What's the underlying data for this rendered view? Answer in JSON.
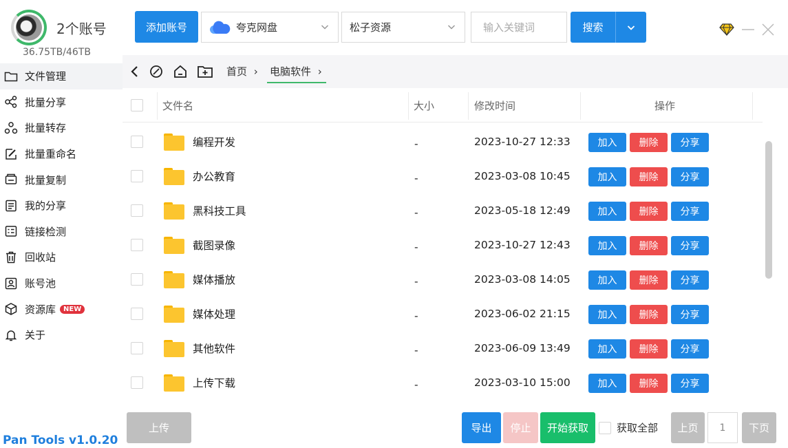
{
  "account": {
    "count_label": "2个账号",
    "storage": "36.75TB/46TB"
  },
  "sidebar": {
    "items": [
      {
        "label": "文件管理",
        "icon": "folder-icon",
        "active": true
      },
      {
        "label": "批量分享",
        "icon": "share-icon"
      },
      {
        "label": "批量转存",
        "icon": "transfer-icon"
      },
      {
        "label": "批量重命名",
        "icon": "rename-icon"
      },
      {
        "label": "批量复制",
        "icon": "copy-icon"
      },
      {
        "label": "我的分享",
        "icon": "my-share-icon"
      },
      {
        "label": "链接检测",
        "icon": "link-check-icon"
      },
      {
        "label": "回收站",
        "icon": "trash-icon"
      },
      {
        "label": "账号池",
        "icon": "account-pool-icon"
      },
      {
        "label": "资源库",
        "icon": "resource-icon",
        "badge": "NEW"
      },
      {
        "label": "关于",
        "icon": "bell-icon"
      }
    ],
    "version": "Pan Tools v1.0.20"
  },
  "topbar": {
    "add_account": "添加账号",
    "drive_select": "夸克网盘",
    "source_select": "松子资源",
    "search_placeholder": "输入关键词",
    "search_button": "搜索"
  },
  "breadcrumb": {
    "items": [
      "首页",
      "电脑软件"
    ]
  },
  "table": {
    "headers": {
      "name": "文件名",
      "size": "大小",
      "modified": "修改时间",
      "actions": "操作"
    },
    "action_labels": {
      "add": "加入",
      "delete": "删除",
      "share": "分享"
    },
    "rows": [
      {
        "name": "编程开发",
        "size": "-",
        "modified": "2023-10-27 12:33"
      },
      {
        "name": "办公教育",
        "size": "-",
        "modified": "2023-03-08 10:45"
      },
      {
        "name": "黑科技工具",
        "size": "-",
        "modified": "2023-05-18 12:49"
      },
      {
        "name": "截图录像",
        "size": "-",
        "modified": "2023-10-27 12:43"
      },
      {
        "name": "媒体播放",
        "size": "-",
        "modified": "2023-03-08 14:05"
      },
      {
        "name": "媒体处理",
        "size": "-",
        "modified": "2023-06-02 21:15"
      },
      {
        "name": "其他软件",
        "size": "-",
        "modified": "2023-06-09 13:49"
      },
      {
        "name": "上传下载",
        "size": "-",
        "modified": "2023-03-10 15:00"
      }
    ]
  },
  "footer": {
    "upload": "上传",
    "export": "导出",
    "stop": "停止",
    "start": "开始获取",
    "fetch_all": "获取全部",
    "prev_page": "上页",
    "page": "1",
    "next_page": "下页"
  },
  "colors": {
    "primary": "#1e88e5",
    "danger": "#ee4d4d",
    "success": "#19be6b",
    "brand_text": "#1f7fdd"
  }
}
